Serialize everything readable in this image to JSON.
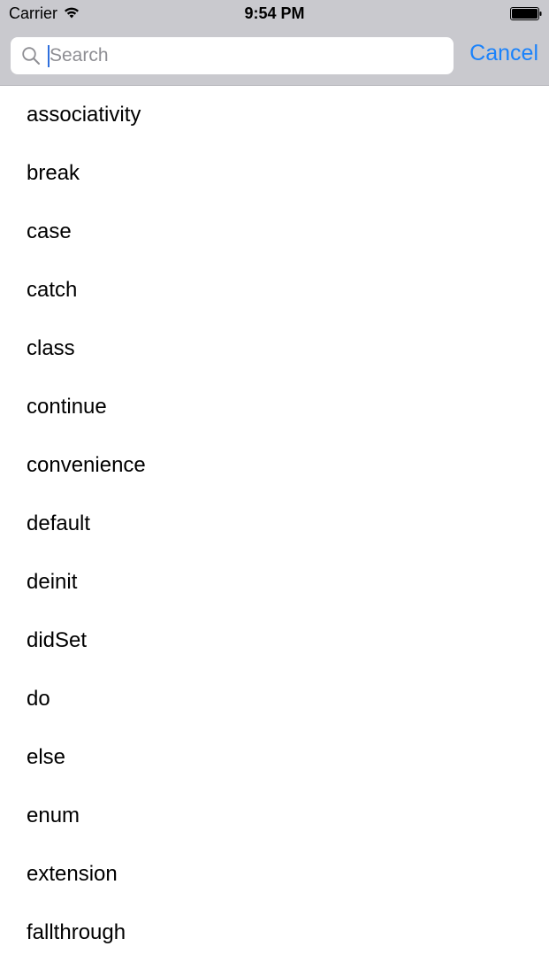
{
  "status_bar": {
    "carrier": "Carrier",
    "time": "9:54 PM",
    "icons": [
      "wifi-icon",
      "battery-icon"
    ]
  },
  "search": {
    "placeholder": "Search",
    "value": "",
    "icon": "search-icon",
    "cancel_label": "Cancel"
  },
  "colors": {
    "accent": "#1a82fb",
    "search_bar_bg": "#c9c9ce",
    "placeholder": "#8e8e93",
    "caret": "#2f6fdd"
  },
  "list": {
    "items": [
      "associativity",
      "break",
      "case",
      "catch",
      "class",
      "continue",
      "convenience",
      "default",
      "deinit",
      "didSet",
      "do",
      "else",
      "enum",
      "extension",
      "fallthrough"
    ]
  }
}
